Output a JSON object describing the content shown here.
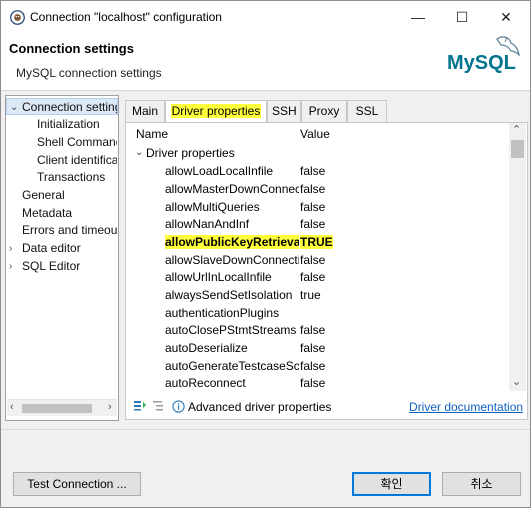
{
  "window": {
    "title": "Connection \"localhost\" configuration",
    "minimize_glyph": "—",
    "maximize_glyph": "☐",
    "close_glyph": "✕"
  },
  "header": {
    "title": "Connection settings",
    "subtitle": "MySQL connection settings",
    "logo_text": "MySQL"
  },
  "tree": {
    "items": [
      {
        "label": "Connection settings",
        "arrow": "⌄"
      },
      {
        "label": "Initialization"
      },
      {
        "label": "Shell Commands"
      },
      {
        "label": "Client identification"
      },
      {
        "label": "Transactions"
      },
      {
        "label": "General"
      },
      {
        "label": "Metadata"
      },
      {
        "label": "Errors and timeouts"
      },
      {
        "label": "Data editor",
        "arrow": "›"
      },
      {
        "label": "SQL Editor",
        "arrow": "›"
      }
    ]
  },
  "tabs": [
    "Main",
    "Driver properties",
    "SSH",
    "Proxy",
    "SSL"
  ],
  "properties": {
    "col_name": "Name",
    "col_value": "Value",
    "group": "Driver properties",
    "rows": [
      {
        "name": "allowLoadLocalInfile",
        "value": "false"
      },
      {
        "name": "allowMasterDownConnections",
        "value": "false"
      },
      {
        "name": "allowMultiQueries",
        "value": "false"
      },
      {
        "name": "allowNanAndInf",
        "value": "false"
      },
      {
        "name": "allowPublicKeyRetrieval",
        "value": "TRUE"
      },
      {
        "name": "allowSlaveDownConnections",
        "value": "false"
      },
      {
        "name": "allowUrlInLocalInfile",
        "value": "false"
      },
      {
        "name": "alwaysSendSetIsolation",
        "value": "true"
      },
      {
        "name": "authenticationPlugins",
        "value": ""
      },
      {
        "name": "autoClosePStmtStreams",
        "value": "false"
      },
      {
        "name": "autoDeserialize",
        "value": "false"
      },
      {
        "name": "autoGenerateTestcaseScript",
        "value": "false"
      },
      {
        "name": "autoReconnect",
        "value": "false"
      }
    ],
    "advanced_label": "Advanced driver properties",
    "doc_link": "Driver documentation"
  },
  "buttons": {
    "test_connection": "Test Connection ...",
    "ok": "확인",
    "cancel": "취소"
  },
  "colors": {
    "highlight": "#ffff3c",
    "link": "#1060c0",
    "logo_blue": "#00758f",
    "logo_orange": "#f29111"
  }
}
